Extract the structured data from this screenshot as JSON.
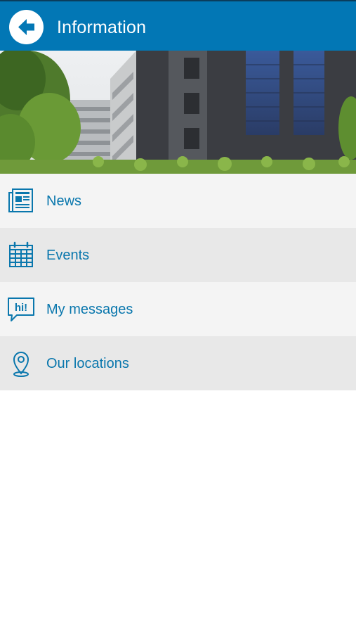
{
  "header": {
    "title": "Information",
    "back_icon": "arrow-left-icon",
    "background_color": "#0277b5"
  },
  "banner": {
    "image": "office-building-photo"
  },
  "menu": {
    "accent_color": "#0a77ad",
    "items": [
      {
        "label": "News",
        "icon": "newspaper-icon"
      },
      {
        "label": "Events",
        "icon": "calendar-icon"
      },
      {
        "label": "My messages",
        "icon": "speech-bubble-icon"
      },
      {
        "label": "Our locations",
        "icon": "location-pin-icon"
      }
    ]
  },
  "speech_bubble_text": "hi!"
}
